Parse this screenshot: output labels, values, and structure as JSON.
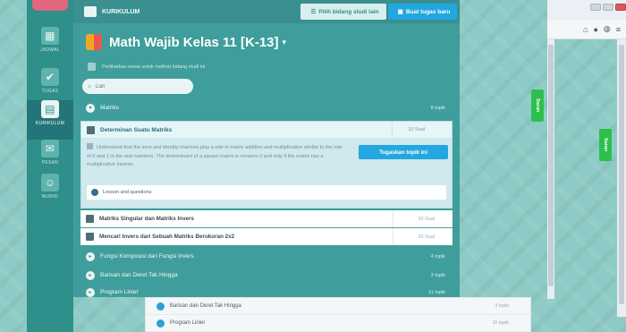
{
  "sidebar": {
    "items": [
      {
        "label": "JADWAL",
        "icon": "calendar-icon"
      },
      {
        "label": "TUGAS",
        "icon": "checkbox-icon"
      },
      {
        "label": "KURIKULUM",
        "icon": "book-icon",
        "active": true
      },
      {
        "label": "PESAN",
        "icon": "chat-icon"
      },
      {
        "label": "MURID",
        "icon": "students-icon"
      }
    ]
  },
  "topbar": {
    "title": "KURIKULUM",
    "pilih_label": "Pilih bidang studi lain",
    "buat_label": "Buat tugas baru"
  },
  "course": {
    "title": "Math Wajib Kelas 11 [K-13]",
    "checkbox_label": "Perlihatkan siswa untuk melihat bidang studi ini",
    "search_placeholder": "Cari"
  },
  "topics": {
    "matriks": {
      "label": "Matriks",
      "count": "8 topik"
    },
    "expanded": {
      "title": "Determinan Suatu Matriks",
      "count": "10 Soal",
      "description": "Understand that the zero and identity matrices play a role in matrix addition and multiplication similar to the role of 0 and 1 in the real numbers. The determinant of a square matrix is nonzero if and only if the matrix has a multiplicative inverse.",
      "assign_label": "Tugaskan topik ini",
      "lesson_label": "Lesson and questions"
    },
    "sub1": {
      "label": "Matriks Singular dan Matriks Invers",
      "count": "10 Soal"
    },
    "sub2": {
      "label": "Mencari Invers dari Sebuah Matriks Berukuran 2x2",
      "count": "10 Soal"
    },
    "fungsi": {
      "label": "Fungsi Komposisi dan Fungsi Invers",
      "count": "4 topik"
    },
    "barisan": {
      "label": "Barisan dan Deret Tak Hingga",
      "count": "3 topik"
    },
    "program": {
      "label": "Program Linier",
      "count": "11 topik"
    }
  },
  "overlay": {
    "row1": {
      "label": "Barisan dan Deret Tak Hingga",
      "count": "3 topik"
    },
    "row2": {
      "label": "Program Linier",
      "count": "11 topik"
    }
  },
  "feedback": {
    "label": "Saran"
  },
  "colors": {
    "accent": "#23a7e0",
    "teal": "#3f9e9b",
    "green_tab": "#2dbf4e"
  }
}
